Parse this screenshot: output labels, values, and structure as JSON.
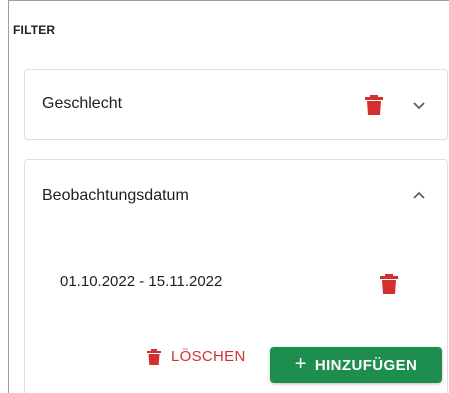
{
  "filter": {
    "title": "FILTER"
  },
  "panels": [
    {
      "label": "Geschlecht",
      "expanded": false
    },
    {
      "label": "Beobachtungsdatum",
      "expanded": true,
      "entry": "01.10.2022 - 15.11.2022"
    }
  ],
  "actions": {
    "delete_label": "LÖSCHEN",
    "add_label": "HINZUFÜGEN",
    "add_icon": "+"
  },
  "colors": {
    "accent": "#1e8e4f",
    "danger": "#d32f2f"
  }
}
